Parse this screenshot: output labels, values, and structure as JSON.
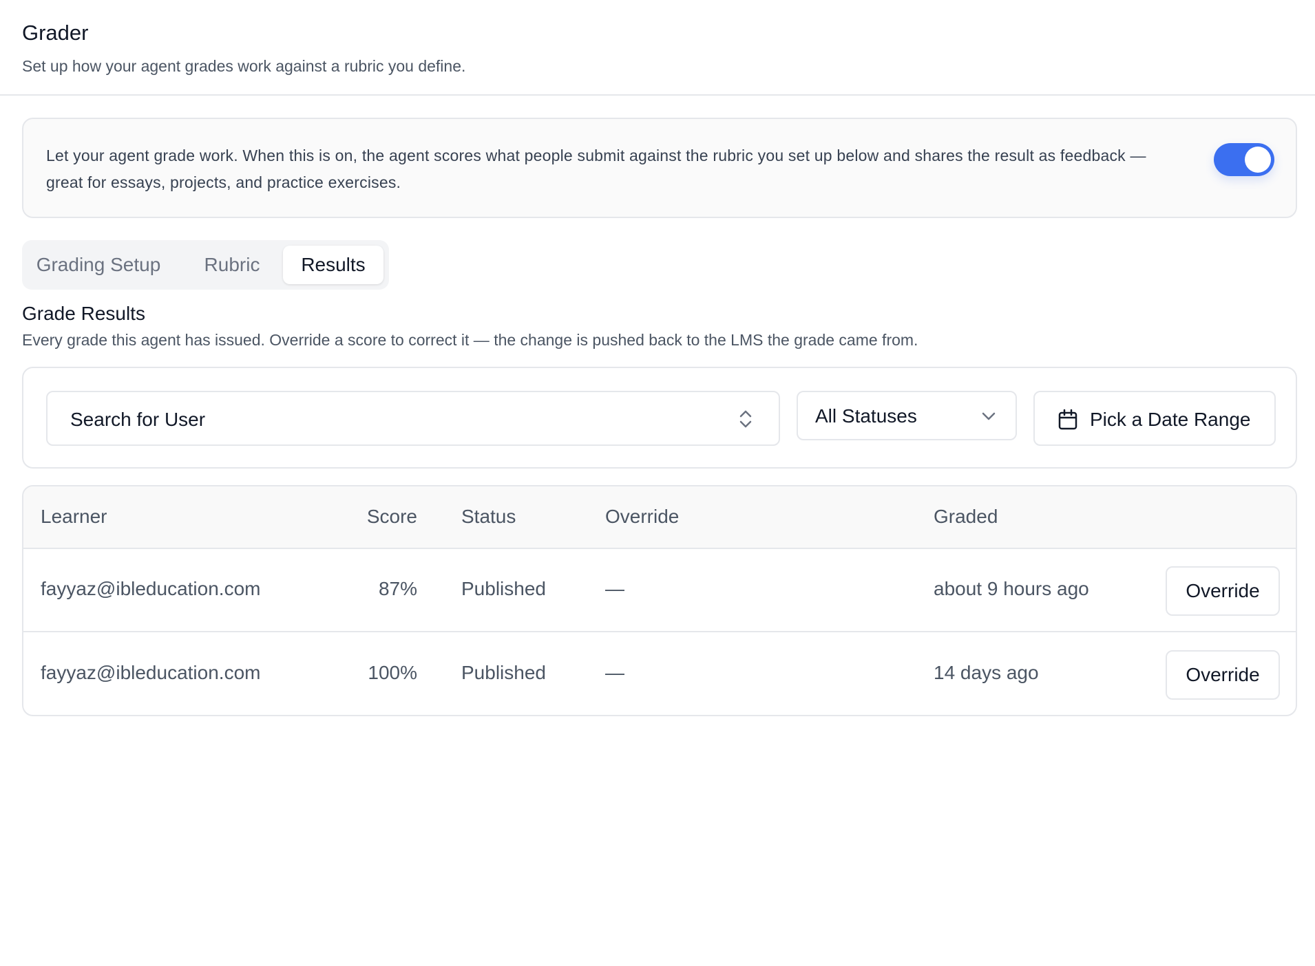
{
  "header": {
    "title": "Grader",
    "subtitle": "Set up how your agent grades work against a rubric you define."
  },
  "grading_toggle": {
    "description": "Let your agent grade work. When this is on, the agent scores what people submit against the rubric you set up below and shares the result as feedback — great for essays, projects, and practice exercises.",
    "enabled": true,
    "accent_color": "#3b6ff0"
  },
  "tabs": [
    {
      "label": "Grading Setup",
      "active": false
    },
    {
      "label": "Rubric",
      "active": false
    },
    {
      "label": "Results",
      "active": true
    }
  ],
  "results_section": {
    "title": "Grade Results",
    "subtitle": "Every grade this agent has issued. Override a score to correct it — the change is pushed back to the LMS the grade came from."
  },
  "filters": {
    "search_label": "Search for User",
    "status_selected": "All Statuses",
    "date_range_label": "Pick a Date Range",
    "icons": [
      "chevron-up-down-icon",
      "chevron-down-icon",
      "calendar-icon"
    ]
  },
  "table": {
    "columns": [
      "Learner",
      "Score",
      "Status",
      "Override",
      "Graded"
    ],
    "rows": [
      {
        "learner": "fayyaz@ibleducation.com",
        "score": "87%",
        "status": "Published",
        "override": "—",
        "graded": "about 9 hours ago",
        "action": "Override"
      },
      {
        "learner": "fayyaz@ibleducation.com",
        "score": "100%",
        "status": "Published",
        "override": "—",
        "graded": "14 days ago",
        "action": "Override"
      }
    ]
  }
}
